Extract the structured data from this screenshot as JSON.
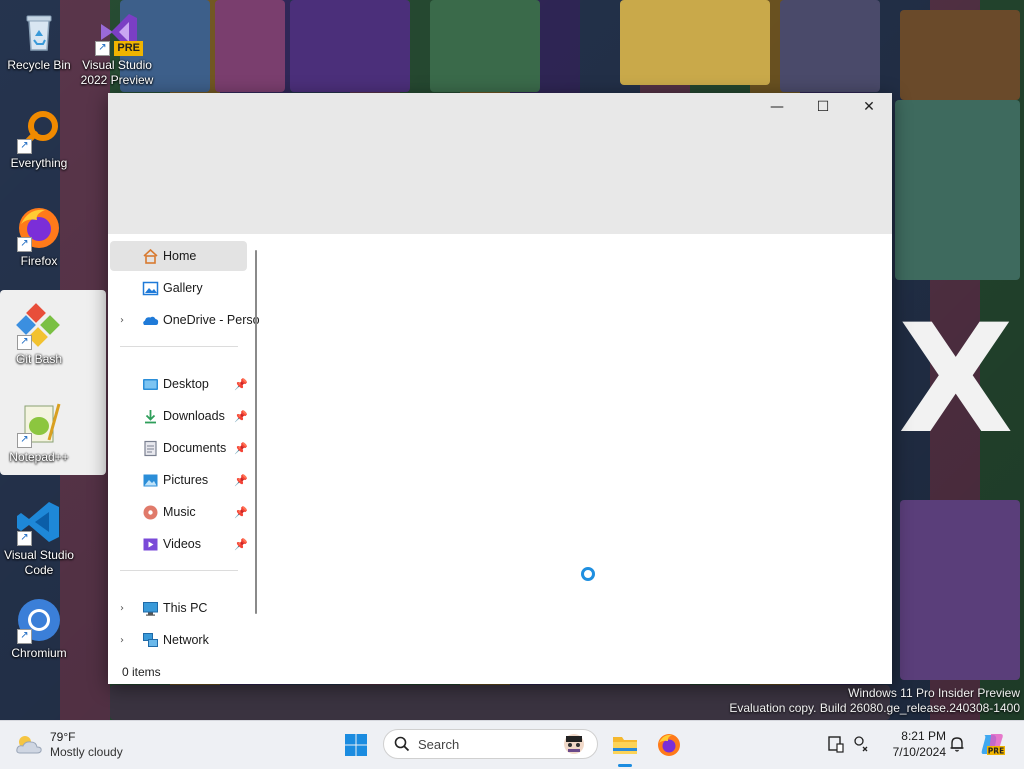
{
  "desktop": {
    "icons": [
      {
        "label": "Recycle Bin"
      },
      {
        "label": "Visual Studio 2022 Preview",
        "badge": "PRE"
      },
      {
        "label": "Everything"
      },
      {
        "label": "Firefox"
      },
      {
        "label": "Git Bash"
      },
      {
        "label": "Notepad++"
      },
      {
        "label": "Visual Studio Code"
      },
      {
        "label": "Chromium"
      }
    ],
    "wallpaper_text": "X",
    "watermark": {
      "line1": "Windows 11 Pro Insider Preview",
      "line2": "Evaluation copy. Build 26080.ge_release.240308-1400"
    }
  },
  "window": {
    "controls": {
      "minimize": "—",
      "maximize": "☐",
      "close": "✕"
    },
    "nav": {
      "items": [
        {
          "label": "Home",
          "icon": "home-icon",
          "selected": true
        },
        {
          "label": "Gallery",
          "icon": "gallery-icon"
        },
        {
          "label": "OneDrive - Perso",
          "icon": "onedrive-icon",
          "expandable": true
        },
        {
          "label": "Desktop",
          "icon": "desktop-folder-icon",
          "pinned": true
        },
        {
          "label": "Downloads",
          "icon": "downloads-icon",
          "pinned": true
        },
        {
          "label": "Documents",
          "icon": "documents-icon",
          "pinned": true
        },
        {
          "label": "Pictures",
          "icon": "pictures-icon",
          "pinned": true
        },
        {
          "label": "Music",
          "icon": "music-icon",
          "pinned": true
        },
        {
          "label": "Videos",
          "icon": "videos-icon",
          "pinned": true
        },
        {
          "label": "This PC",
          "icon": "this-pc-icon",
          "expandable": true
        },
        {
          "label": "Network",
          "icon": "network-icon",
          "expandable": true
        }
      ]
    },
    "status": "0 items",
    "state": "loading"
  },
  "taskbar": {
    "weather": {
      "temp": "79°F",
      "desc": "Mostly cloudy"
    },
    "search_label": "Search",
    "clock": {
      "time": "8:21 PM",
      "date": "7/10/2024"
    }
  },
  "colors": {
    "accent": "#1f8fe0",
    "titlebar": "#e8e8e8",
    "taskbar": "#eef0f4"
  }
}
